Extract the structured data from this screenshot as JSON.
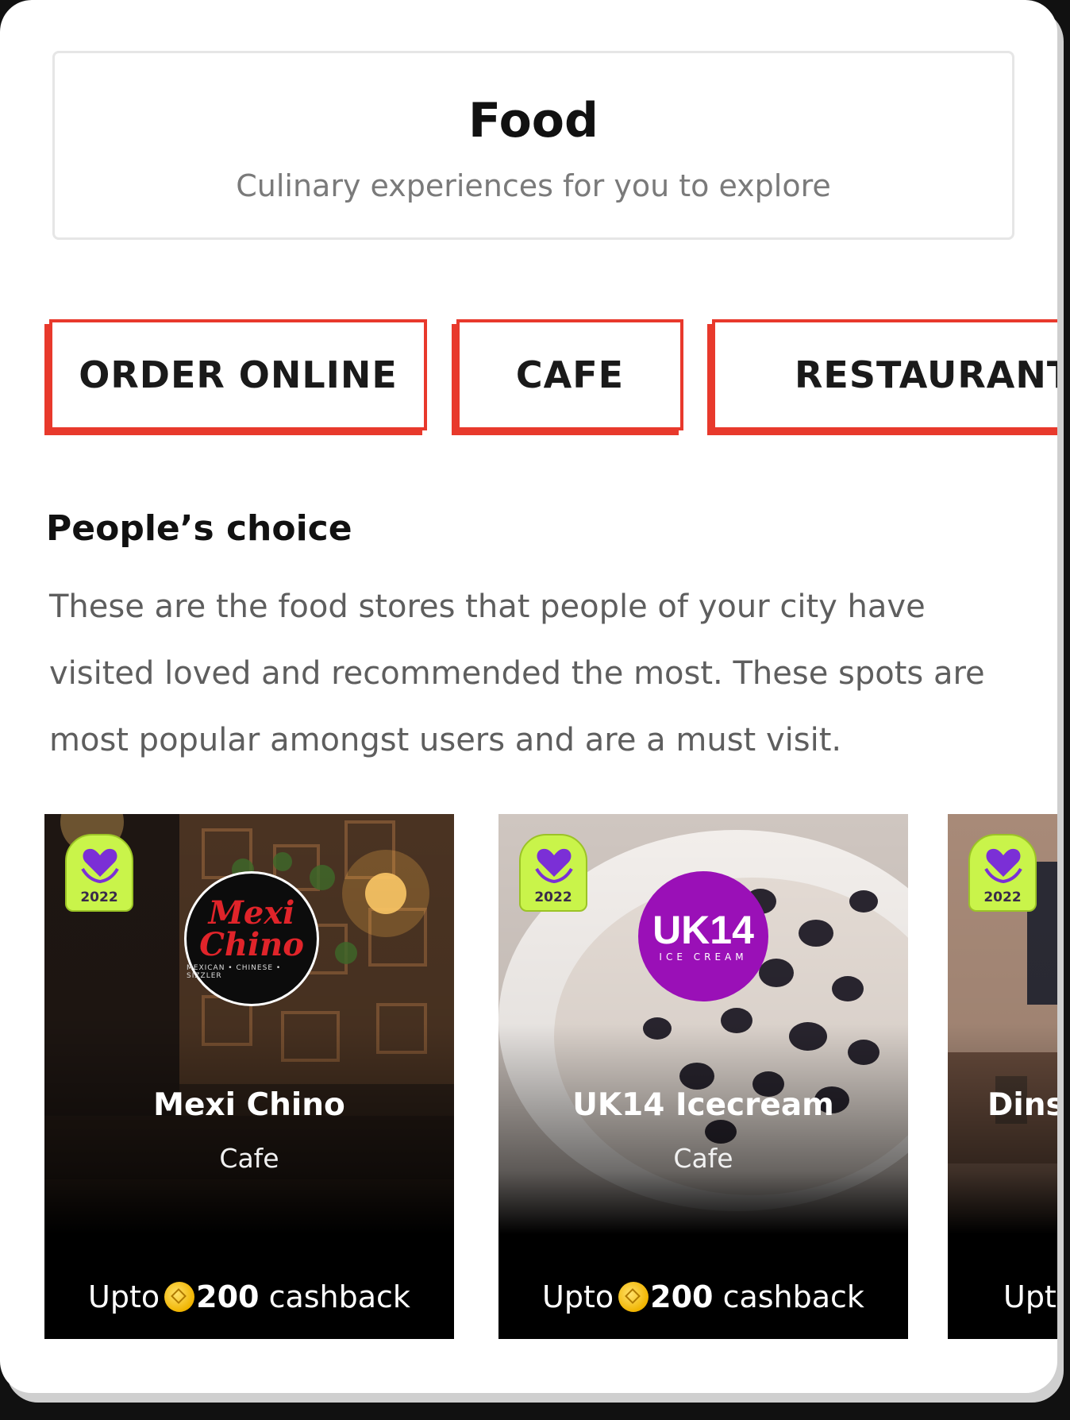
{
  "header": {
    "title": "Food",
    "subtitle": "Culinary experiences for you to explore"
  },
  "tabs": [
    {
      "label": "ORDER ONLINE"
    },
    {
      "label": "CAFE"
    },
    {
      "label": "RESTAURANT"
    }
  ],
  "section": {
    "title": "People’s choice",
    "description": "These are the food stores that people of your city have visited loved and recommended the most. These spots are most popular amongst users and are a must visit."
  },
  "cards": [
    {
      "name": "Mexi Chino",
      "category": "Cafe",
      "award_year": "2022",
      "logo_text": "Mexi Chino",
      "logo_sub": "MEXICAN • CHINESE • SIZZLER",
      "cashback_prefix": "Upto",
      "cashback_amount": "200",
      "cashback_suffix": "cashback"
    },
    {
      "name": "UK14 Icecream",
      "category": "Cafe",
      "award_year": "2022",
      "logo_text": "UK14",
      "logo_sub": "ICE CREAM",
      "cashback_prefix": "Upto",
      "cashback_amount": "200",
      "cashback_suffix": "cashback"
    },
    {
      "name": "Dinsl",
      "award_year": "2022",
      "cashback_prefix": "Uptc"
    }
  ],
  "colors": {
    "accent": "#e8392c",
    "award_badge": "#c9f44a",
    "award_heart": "#7b2fd6",
    "coin": "#f0b400"
  },
  "icons": {
    "award": "heart-laurel-badge-icon",
    "coin": "coin-icon"
  }
}
